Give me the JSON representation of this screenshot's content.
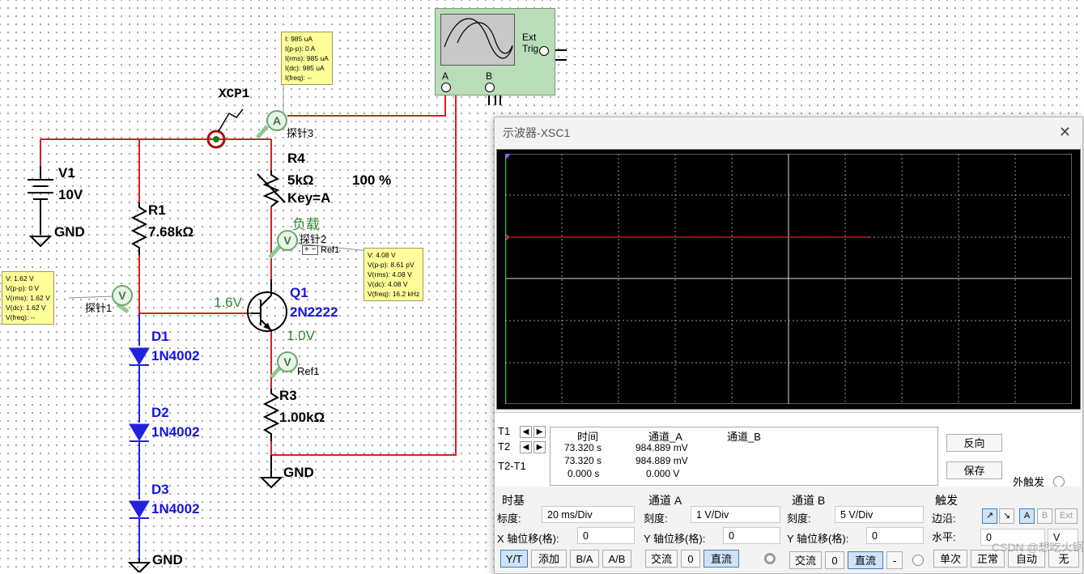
{
  "circuit": {
    "xcp_label": "XCP1",
    "v1": {
      "name": "V1",
      "value": "10V"
    },
    "gnd": "GND",
    "r1": {
      "name": "R1",
      "value": "7.68kΩ"
    },
    "r4": {
      "name": "R4",
      "value": "5kΩ",
      "key": "Key=A",
      "percent": "100 %"
    },
    "load": "负载",
    "q1": {
      "name": "Q1",
      "model": "2N2222",
      "vb": "1.6V",
      "ve": "1.0V"
    },
    "r3": {
      "name": "R3",
      "value": "1.00kΩ"
    },
    "d1": {
      "name": "D1",
      "model": "1N4002"
    },
    "d2": {
      "name": "D2",
      "model": "1N4002"
    },
    "d3": {
      "name": "D3",
      "model": "1N4002"
    },
    "ref1": "Ref1",
    "ref1b": "Ref1"
  },
  "probes": {
    "probe1": {
      "label": "探针1",
      "lines": [
        "V: 1.62 V",
        "V(p-p): 0 V",
        "V(rms): 1.62 V",
        "V(dc): 1.62 V",
        "V(freq): --"
      ]
    },
    "probe2": {
      "label": "探针2",
      "lines": [
        "V: 4.08 V",
        "V(p-p): 8.61 pV",
        "V(rms): 4.08 V",
        "V(dc): 4.08 V",
        "V(freq): 16.2 kHz"
      ]
    },
    "probe3": {
      "label": "探针3",
      "lines": [
        "I: 985 uA",
        "I(p-p): 0 A",
        "I(rms): 985 uA",
        "I(dc): 985 uA",
        "I(freq): --"
      ]
    }
  },
  "scope_icon": {
    "a": "A",
    "b": "B",
    "ext_trig": "Ext Trig"
  },
  "window": {
    "title": "示波器-XSC1",
    "close": "✕",
    "readout": {
      "headers": [
        "时间",
        "通道_A",
        "通道_B"
      ],
      "t1": {
        "label": "T1",
        "time": "73.320 s",
        "a": "984.889 mV",
        "b": ""
      },
      "t2": {
        "label": "T2",
        "time": "73.320 s",
        "a": "984.889 mV",
        "b": ""
      },
      "dt": {
        "label": "T2-T1",
        "time": "0.000 s",
        "a": "0.000 V",
        "b": ""
      }
    },
    "buttons": {
      "reverse": "反向",
      "save": "保存",
      "ext_trigger": "外触发"
    },
    "timebase": {
      "title": "时基",
      "scale_label": "标度:",
      "scale": "20 ms/Div",
      "xpos_label": "X 轴位移(格):",
      "xpos": "0",
      "modes": [
        "Y/T",
        "添加",
        "B/A",
        "A/B"
      ]
    },
    "channel_a": {
      "title": "通道 A",
      "scale_label": "刻度:",
      "scale": "1  V/Div",
      "ypos_label": "Y 轴位移(格):",
      "ypos": "0",
      "ac": "交流",
      "zero": "0",
      "dc": "直流"
    },
    "channel_b": {
      "title": "通道 B",
      "scale_label": "刻度:",
      "scale": "5  V/Div",
      "ypos_label": "Y 轴位移(格):",
      "ypos": "0",
      "ac": "交流",
      "zero": "0",
      "dc": "直流",
      "minus": "-"
    },
    "trigger": {
      "title": "触发",
      "edge_label": "边沿:",
      "level_label": "水平:",
      "level": "0",
      "unit": "V",
      "edge_rise": "↗",
      "edge_fall": "↘",
      "src_a": "A",
      "src_b": "B",
      "src_ext": "Ext",
      "modes": [
        "单次",
        "正常",
        "自动",
        "无"
      ]
    }
  },
  "watermark": "CSDN @想吃火锅"
}
